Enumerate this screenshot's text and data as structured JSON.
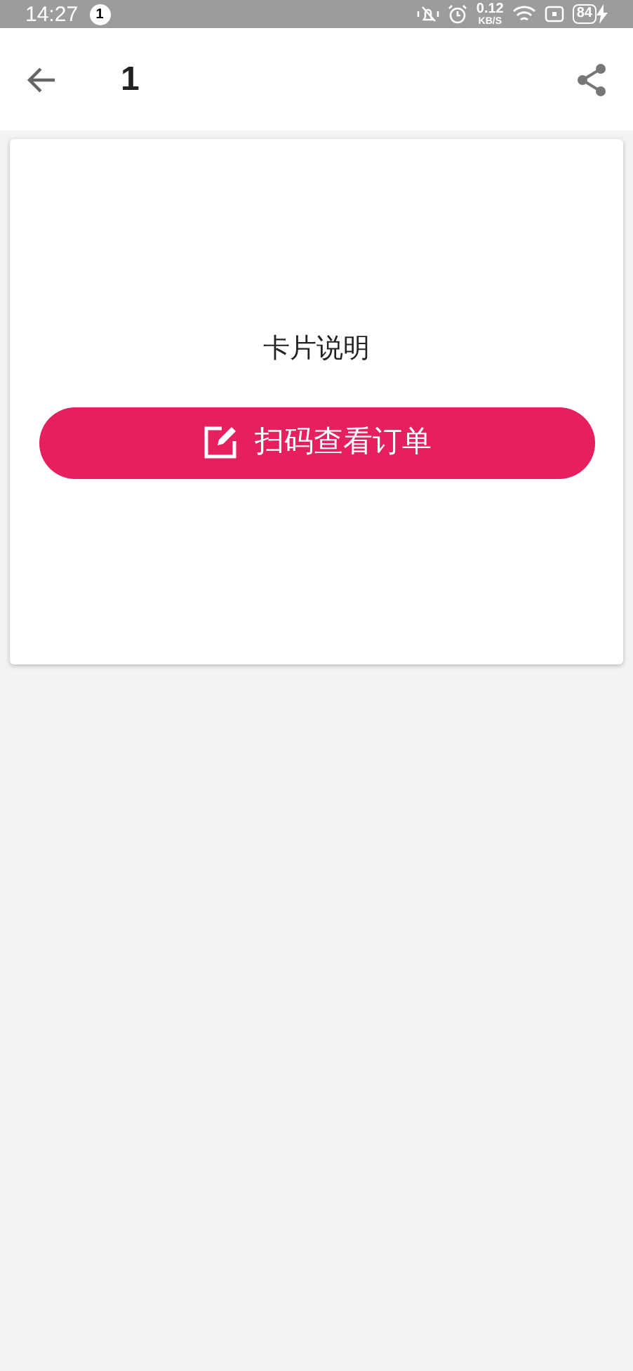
{
  "status_bar": {
    "time": "14:27",
    "notification_count": "1",
    "speed_value": "0.12",
    "speed_unit": "KB/S",
    "battery": "84"
  },
  "app_bar": {
    "title": "1"
  },
  "card": {
    "description": "卡片说明",
    "button": "扫码查看订单"
  }
}
